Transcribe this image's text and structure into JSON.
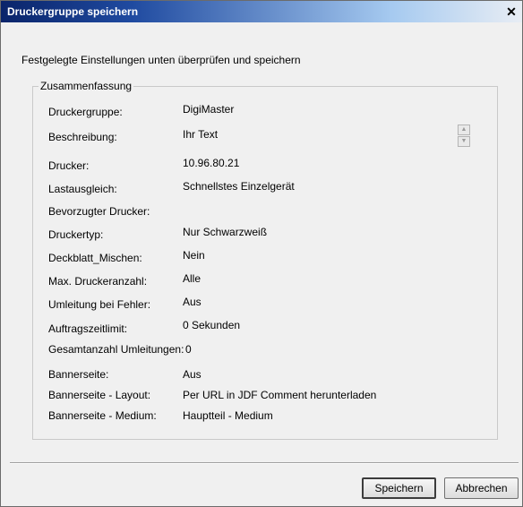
{
  "window": {
    "title": "Druckergruppe speichern",
    "close_glyph": "✕"
  },
  "instruction": "Festgelegte Einstellungen unten überprüfen und speichern",
  "summary": {
    "legend": "Zusammenfassung",
    "rows": [
      {
        "label": "Druckergruppe:",
        "value": "DigiMaster"
      },
      {
        "label": "Beschreibung:",
        "value": "Ihr Text"
      },
      {
        "label": "Drucker:",
        "value": "10.96.80.21"
      },
      {
        "label": "Lastausgleich:",
        "value": "Schnellstes Einzelgerät"
      },
      {
        "label": "Bevorzugter Drucker:",
        "value": ""
      },
      {
        "label": "Druckertyp:",
        "value": "Nur Schwarzweiß"
      },
      {
        "label": "Deckblatt_Mischen:",
        "value": "Nein"
      },
      {
        "label": "Max. Druckeranzahl:",
        "value": "Alle"
      },
      {
        "label": "Umleitung bei Fehler:",
        "value": "Aus"
      },
      {
        "label": "Auftragszeitlimit:",
        "value": "0 Sekunden"
      },
      {
        "label": "Gesamtanzahl Umleitungen:",
        "value": "0"
      },
      {
        "label": "Bannerseite:",
        "value": "Aus"
      },
      {
        "label": "Bannerseite - Layout:",
        "value": "Per URL in JDF Comment herunterladen"
      },
      {
        "label": "Bannerseite - Medium:",
        "value": "Hauptteil - Medium"
      }
    ]
  },
  "description_scroll": {
    "up_glyph": "▲",
    "down_glyph": "▼"
  },
  "buttons": {
    "save": "Speichern",
    "cancel": "Abbrechen"
  }
}
